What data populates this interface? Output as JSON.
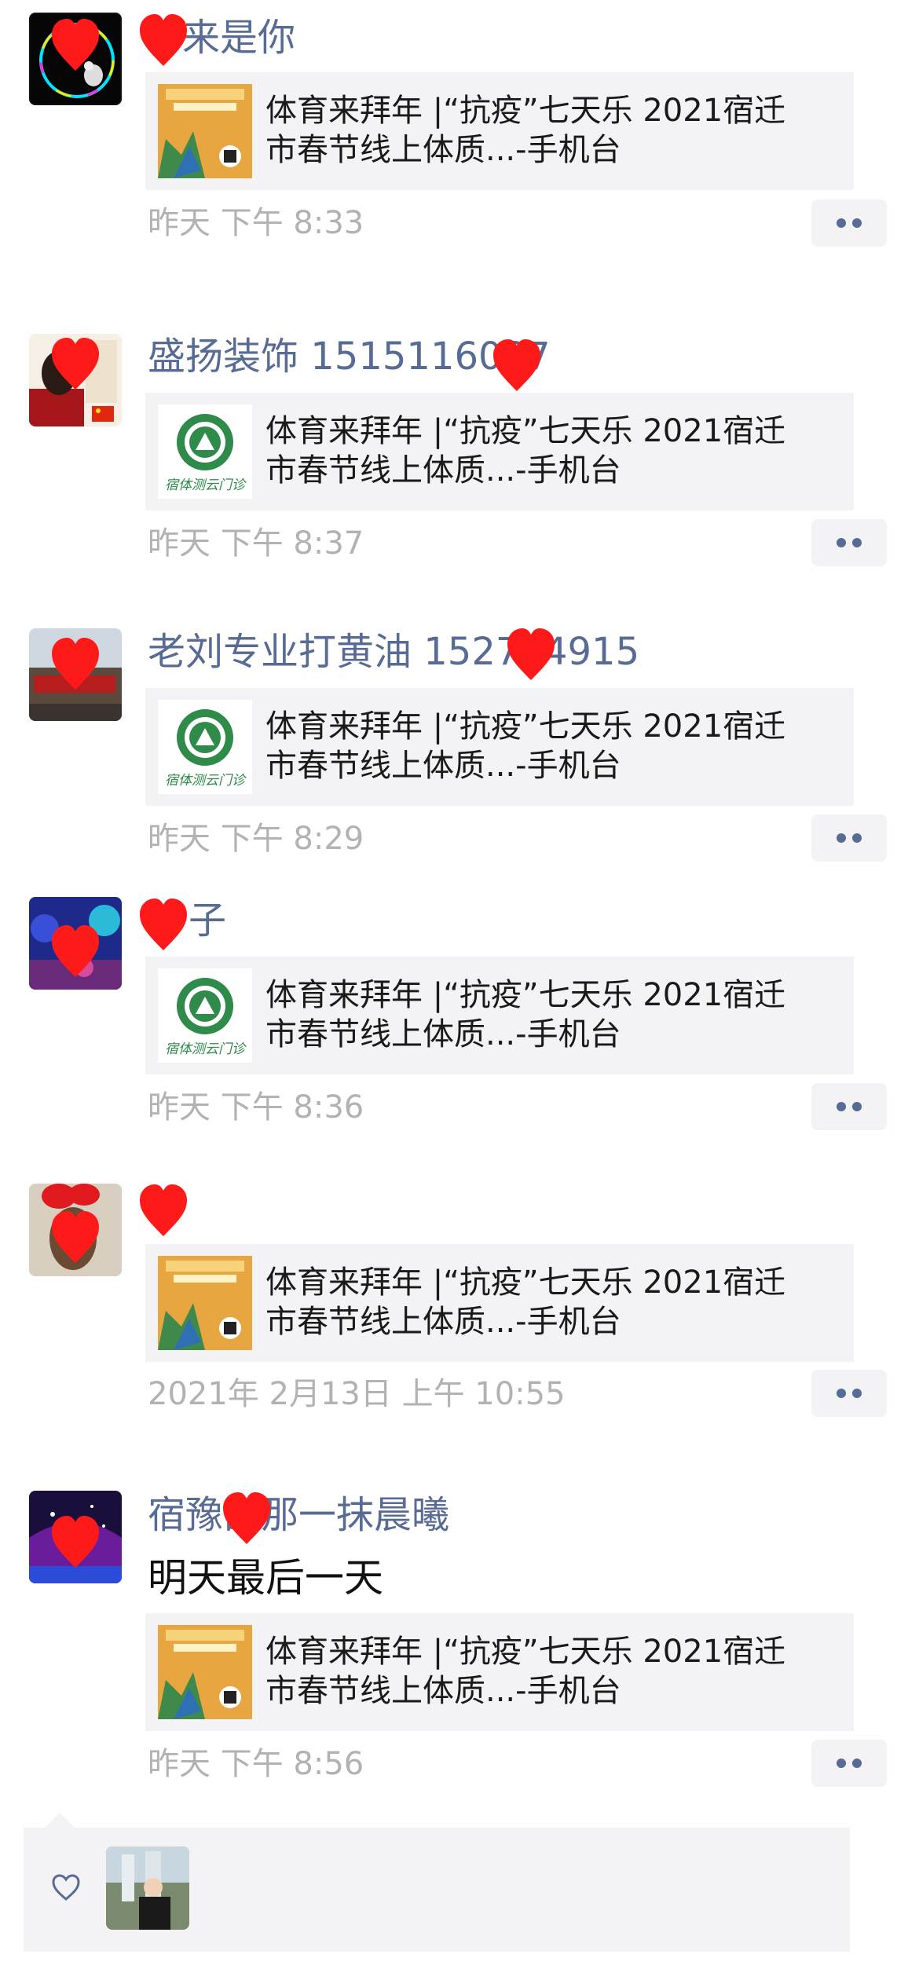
{
  "posts": [
    {
      "name": "来是你",
      "text": "",
      "link_line1": "体育来拜年 |“抗疫”七天乐 2021宿迁",
      "link_line2": "市春节线上体质...-手机台",
      "time": "昨天  下午 8:33",
      "thumb": "poster"
    },
    {
      "name": "盛扬装饰 1515116087",
      "text": "",
      "link_line1": "体育来拜年 |“抗疫”七天乐 2021宿迁",
      "link_line2": "市春节线上体质...-手机台",
      "time": "昨天  下午 8:37",
      "thumb": "logo"
    },
    {
      "name": "老刘专业打黄油 152764915",
      "text": "",
      "link_line1": "体育来拜年 |“抗疫”七天乐 2021宿迁",
      "link_line2": "市春节线上体质...-手机台",
      "time": "昨天  下午 8:29",
      "thumb": "logo"
    },
    {
      "name": "子",
      "text": "",
      "link_line1": "体育来拜年 |“抗疫”七天乐 2021宿迁",
      "link_line2": "市春节线上体质...-手机台",
      "time": "昨天  下午 8:36",
      "thumb": "logo"
    },
    {
      "name": "",
      "text": "",
      "link_line1": "体育来拜年 |“抗疫”七天乐 2021宿迁",
      "link_line2": "市春节线上体质...-手机台",
      "time": "2021年 2月13日  上午 10:55",
      "thumb": "poster"
    },
    {
      "name": "宿豫部那一抹晨曦",
      "text": "明天最后一天",
      "link_line1": "体育来拜年 |“抗疫”七天乐 2021宿迁",
      "link_line2": "市春节线上体质...-手机台",
      "time": "昨天  下午 8:56",
      "thumb": "poster"
    }
  ],
  "logo_caption": "宿体测云门诊",
  "colors": {
    "name": "#576b95",
    "time": "#b2b2b2",
    "card_bg": "#f3f3f5",
    "heart": "#ff1a1a",
    "logo_green": "#2e8b4a"
  },
  "icons": {
    "more": "more-dots-icon",
    "like": "heart-outline-icon",
    "redaction": "red-heart-icon"
  }
}
